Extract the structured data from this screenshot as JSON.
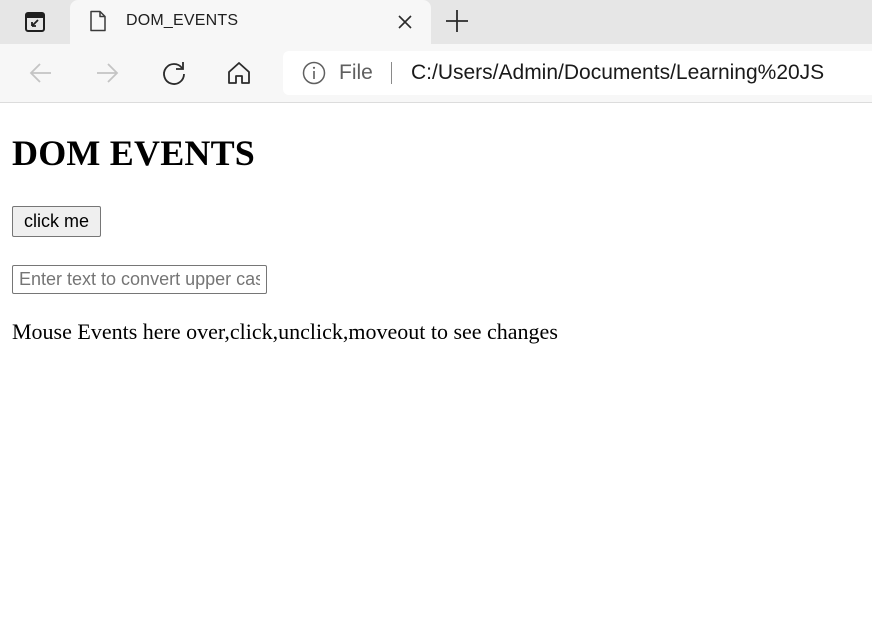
{
  "browser": {
    "tab": {
      "title": "DOM_EVENTS"
    },
    "address_bar": {
      "site_label": "File",
      "url": "C:/Users/Admin/Documents/Learning%20JS"
    },
    "icons": {
      "tab_actions": "tab-actions-icon",
      "favicon": "document-icon",
      "close": "close-icon",
      "new_tab": "plus-icon",
      "back": "back-arrow-icon",
      "forward": "forward-arrow-icon",
      "refresh": "refresh-icon",
      "home": "home-icon",
      "info": "info-icon"
    },
    "colors": {
      "tabstrip_bg": "#e6e6e6",
      "toolbar_bg": "#f7f7f7",
      "disabled_icon": "#c4c4c4",
      "icon": "#2b2b2b"
    }
  },
  "page": {
    "heading": "DOM EVENTS",
    "button_label": "click me",
    "input": {
      "value": "",
      "placeholder": "Enter text to convert upper case"
    },
    "mouse_events_text": "Mouse Events here over,click,unclick,moveout to see changes"
  }
}
